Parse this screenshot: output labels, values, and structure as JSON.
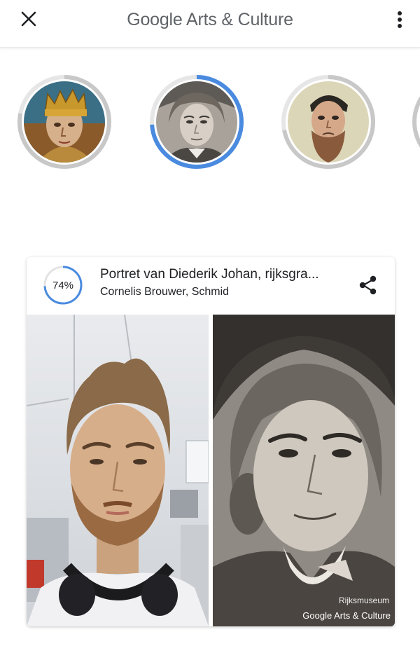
{
  "app": {
    "title": "Google Arts & Culture",
    "brand_google": "Google",
    "brand_rest": " Arts & Culture"
  },
  "topbar": {
    "close_icon": "close-icon",
    "more_icon": "more-vert-icon"
  },
  "matches": [
    {
      "name": "crowned-king-portrait",
      "progress": 0.78,
      "selected": false
    },
    {
      "name": "diederik-johan-portrait",
      "progress": 0.74,
      "selected": true
    },
    {
      "name": "bearded-man-portrait",
      "progress": 0.72,
      "selected": false
    }
  ],
  "card": {
    "score": "74%",
    "score_value": 0.74,
    "title": "Portret van Diederik Johan, rijksgra...",
    "artist": "Cornelis Brouwer, Schmid",
    "share_icon": "share-icon",
    "museum_credit": "Rijksmuseum",
    "brand_credit": "Google Arts & Culture"
  },
  "colors": {
    "accent": "#4a8be0",
    "ring_grey": "#c8c8c8",
    "text": "#202124",
    "brand_grey": "#5f6368"
  }
}
